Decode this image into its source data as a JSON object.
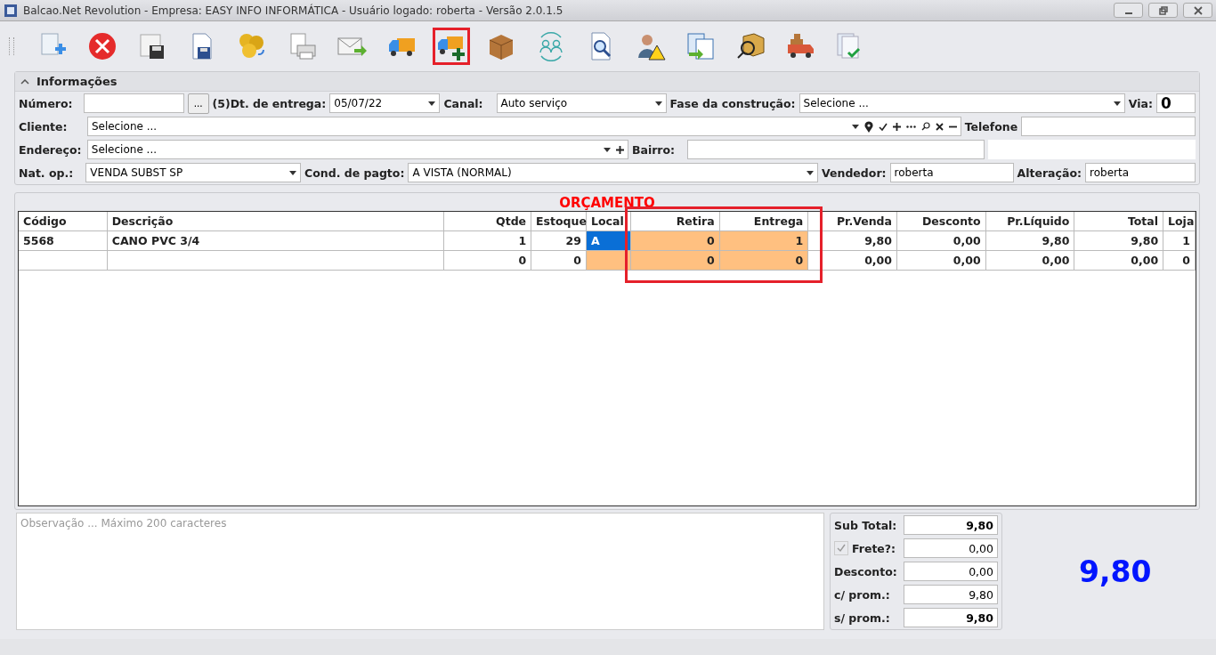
{
  "window": {
    "title": "Balcao.Net Revolution - Empresa: EASY INFO INFORMÁTICA - Usuário logado: roberta - Versão 2.0.1.5"
  },
  "toolbar": [
    {
      "kind": "new",
      "highlighted": false
    },
    {
      "kind": "cancel",
      "highlighted": false
    },
    {
      "kind": "save-table",
      "highlighted": false
    },
    {
      "kind": "save-file",
      "highlighted": false
    },
    {
      "kind": "coins",
      "highlighted": false
    },
    {
      "kind": "print",
      "highlighted": false
    },
    {
      "kind": "mail",
      "highlighted": false
    },
    {
      "kind": "truck",
      "highlighted": false
    },
    {
      "kind": "truck-add",
      "highlighted": true
    },
    {
      "kind": "boxes",
      "highlighted": false
    },
    {
      "kind": "users",
      "highlighted": false
    },
    {
      "kind": "search-doc",
      "highlighted": false
    },
    {
      "kind": "user-warning",
      "highlighted": false
    },
    {
      "kind": "doc-transfer",
      "highlighted": false
    },
    {
      "kind": "box-search",
      "highlighted": false
    },
    {
      "kind": "cargo-truck",
      "highlighted": false
    },
    {
      "kind": "doc-check",
      "highlighted": false
    }
  ],
  "info_panel": {
    "title": "Informações",
    "expanded": true,
    "numero": {
      "label": "Número:",
      "button": "..."
    },
    "dt_entrega": {
      "label": "(5)Dt. de entrega:",
      "value": "05/07/22"
    },
    "canal": {
      "label": "Canal:",
      "value": "Auto serviço"
    },
    "fase": {
      "label": "Fase da construção:",
      "value": "Selecione ..."
    },
    "via": {
      "label": "Via:",
      "value": "0"
    },
    "cliente": {
      "label": "Cliente:",
      "value": "Selecione ..."
    },
    "telefone": {
      "label": "Telefone"
    },
    "endereco": {
      "label": "Endereço:",
      "value": "Selecione ..."
    },
    "bairro": {
      "label": "Bairro:"
    },
    "nat_op": {
      "label": "Nat. op.:",
      "value": "VENDA SUBST SP"
    },
    "cond_pagto": {
      "label": "Cond. de pagto:",
      "value": "A VISTA (NORMAL)"
    },
    "vendedor": {
      "label": "Vendedor:",
      "value": "roberta"
    },
    "alteracao": {
      "label": "Alteração:",
      "value": "roberta"
    }
  },
  "grid": {
    "title": "ORÇAMENTO",
    "columns": [
      {
        "label": "Código",
        "shaded": false
      },
      {
        "label": "Descrição",
        "shaded": false
      },
      {
        "label": "Qtde",
        "shaded": false
      },
      {
        "label": "Estoque",
        "shaded": false
      },
      {
        "label": "Local",
        "shaded": true
      },
      {
        "label": "Retira",
        "shaded": true,
        "highlighted": true
      },
      {
        "label": "Entrega",
        "shaded": true,
        "highlighted": true
      },
      {
        "label": "Pr.Venda",
        "shaded": false
      },
      {
        "label": "Desconto",
        "shaded": false
      },
      {
        "label": "Pr.Líquido",
        "shaded": false
      },
      {
        "label": "Total",
        "shaded": false
      },
      {
        "label": "Loja",
        "shaded": false
      }
    ],
    "rows": [
      {
        "local_focused": true,
        "cells": [
          "5568",
          "CANO PVC 3/4",
          "1",
          "29",
          "A",
          "0",
          "1",
          "9,80",
          "0,00",
          "9,80",
          "9,80",
          "1"
        ]
      },
      {
        "local_focused": false,
        "cells": [
          "",
          "",
          "0",
          "0",
          "",
          "0",
          "0",
          "0,00",
          "0,00",
          "0,00",
          "0,00",
          "0"
        ]
      }
    ]
  },
  "observacao": {
    "placeholder": "Observação ... Máximo 200 caracteres"
  },
  "totals": [
    {
      "label": "Sub Total:",
      "value": "9,80",
      "bold": true
    },
    {
      "label": "Frete?:",
      "value": "0,00",
      "bold": false,
      "kind": "checkbox",
      "checked": true
    },
    {
      "label": "Desconto:",
      "value": "0,00",
      "bold": false
    },
    {
      "label": "c/ prom.:",
      "value": "9,80",
      "bold": false
    },
    {
      "label": "s/ prom.:",
      "value": "9,80",
      "bold": true
    }
  ],
  "grand_total": "9,80"
}
